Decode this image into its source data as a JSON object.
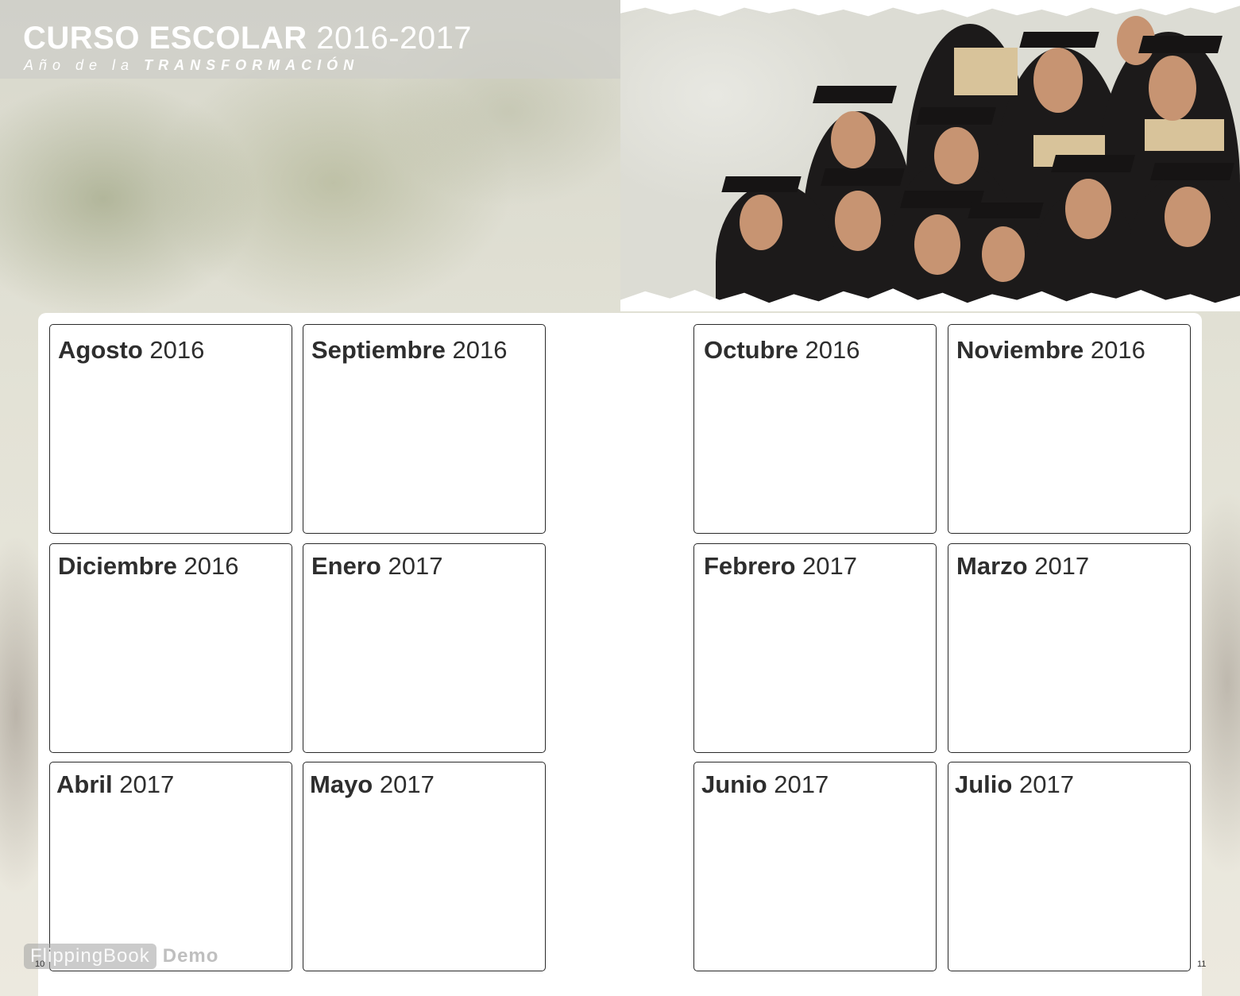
{
  "header": {
    "title_bold": "CURSO ESCOLAR",
    "title_years": "2016-2017",
    "subtitle_lead": "Año de la",
    "subtitle_emphasis": "TRANSFORMACIÓN"
  },
  "photo": {
    "subject": "graduates-photo"
  },
  "months_left": [
    {
      "name": "Agosto",
      "year": "2016"
    },
    {
      "name": "Septiembre",
      "year": "2016"
    },
    {
      "name": "Diciembre",
      "year": "2016"
    },
    {
      "name": "Enero",
      "year": "2017"
    },
    {
      "name": "Abril",
      "year": "2017"
    },
    {
      "name": "Mayo",
      "year": "2017"
    }
  ],
  "months_right": [
    {
      "name": "Octubre",
      "year": "2016"
    },
    {
      "name": "Noviembre",
      "year": "2016"
    },
    {
      "name": "Febrero",
      "year": "2017"
    },
    {
      "name": "Marzo",
      "year": "2017"
    },
    {
      "name": "Junio",
      "year": "2017"
    },
    {
      "name": "Julio",
      "year": "2017"
    }
  ],
  "page_numbers": {
    "left": "10",
    "right": "11"
  },
  "watermark": {
    "logo_text": "FlippingBook",
    "demo_text": "Demo"
  }
}
